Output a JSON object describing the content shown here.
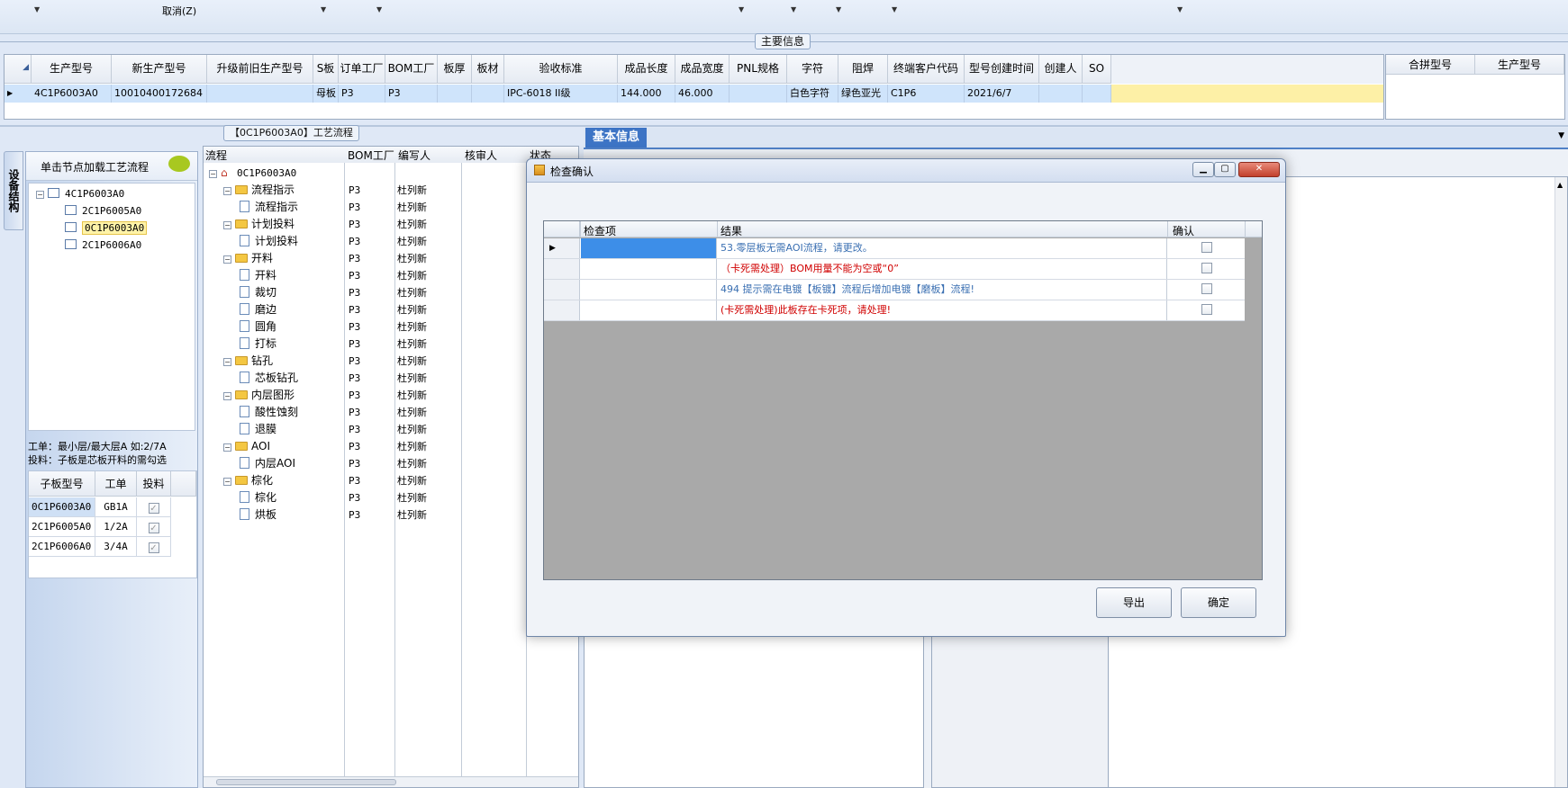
{
  "topbar": {
    "cancel_label": "取消(Z)"
  },
  "main_info": {
    "title": "主要信息",
    "columns": [
      "生产型号",
      "新生产型号",
      "升级前旧生产型号",
      "S板",
      "订单工厂",
      "BOM工厂",
      "板厚",
      "板材",
      "验收标准",
      "成品长度",
      "成品宽度",
      "PNL规格",
      "字符",
      "阻焊",
      "终端客户代码",
      "型号创建时间",
      "创建人",
      "SO"
    ],
    "row": [
      "4C1P6003A0",
      "10010400172684",
      "",
      "母板",
      "P3",
      "P3",
      "",
      "",
      "IPC-6018 II级",
      "144.000",
      "46.000",
      "",
      "白色字符",
      "绿色亚光",
      "C1P6",
      "2021/6/7",
      "",
      ""
    ],
    "side_columns": [
      "合拼型号",
      "生产型号"
    ]
  },
  "left_panel": {
    "vertical_tab": "设备结构",
    "hint": "单击节点加载工艺流程",
    "tree": [
      {
        "label": "4C1P6003A0",
        "level": 0
      },
      {
        "label": "2C1P6005A0",
        "level": 1
      },
      {
        "label": "0C1P6003A0",
        "level": 1,
        "selected": true
      },
      {
        "label": "2C1P6006A0",
        "level": 1
      }
    ],
    "note_line1": "工单：最小层/最大层A 如:2/7A",
    "note_line2": "投料：子板是芯板开料的需勾选",
    "sub_columns": [
      "子板型号",
      "工单",
      "投料"
    ],
    "sub_rows": [
      {
        "model": "0C1P6003A0",
        "order": "GB1A",
        "feed": true
      },
      {
        "model": "2C1P6005A0",
        "order": "1/2A",
        "feed": true
      },
      {
        "model": "2C1P6006A0",
        "order": "3/4A",
        "feed": true
      }
    ]
  },
  "process": {
    "title": "【0C1P6003A0】工艺流程",
    "columns": [
      "流程",
      "BOM工厂",
      "编写人",
      "核审人",
      "状态"
    ],
    "root": "0C1P6003A0",
    "rows": [
      {
        "label": "流程指示",
        "type": "folder",
        "bom": "P3",
        "who": "杜列新"
      },
      {
        "label": "流程指示",
        "type": "doc",
        "bom": "P3",
        "who": "杜列新"
      },
      {
        "label": "计划投料",
        "type": "folder",
        "bom": "P3",
        "who": "杜列新"
      },
      {
        "label": "计划投料",
        "type": "doc",
        "bom": "P3",
        "who": "杜列新"
      },
      {
        "label": "开料",
        "type": "folder",
        "bom": "P3",
        "who": "杜列新"
      },
      {
        "label": "开料",
        "type": "doc",
        "bom": "P3",
        "who": "杜列新"
      },
      {
        "label": "裁切",
        "type": "doc",
        "bom": "P3",
        "who": "杜列新"
      },
      {
        "label": "磨边",
        "type": "doc",
        "bom": "P3",
        "who": "杜列新"
      },
      {
        "label": "圆角",
        "type": "doc",
        "bom": "P3",
        "who": "杜列新"
      },
      {
        "label": "打标",
        "type": "doc",
        "bom": "P3",
        "who": "杜列新"
      },
      {
        "label": "钻孔",
        "type": "folder",
        "bom": "P3",
        "who": "杜列新"
      },
      {
        "label": "芯板钻孔",
        "type": "doc",
        "bom": "P3",
        "who": "杜列新"
      },
      {
        "label": "内层图形",
        "type": "folder",
        "bom": "P3",
        "who": "杜列新"
      },
      {
        "label": "酸性蚀刻",
        "type": "doc",
        "bom": "P3",
        "who": "杜列新"
      },
      {
        "label": "退膜",
        "type": "doc",
        "bom": "P3",
        "who": "杜列新"
      },
      {
        "label": "AOI",
        "type": "folder",
        "bom": "P3",
        "who": "杜列新"
      },
      {
        "label": "内层AOI",
        "type": "doc",
        "bom": "P3",
        "who": "杜列新"
      },
      {
        "label": "棕化",
        "type": "folder",
        "bom": "P3",
        "who": "杜列新"
      },
      {
        "label": "棕化",
        "type": "doc",
        "bom": "P3",
        "who": "杜列新"
      },
      {
        "label": "烘板",
        "type": "doc",
        "bom": "P3",
        "who": "杜列新"
      }
    ]
  },
  "right_tabs": {
    "basic_info": "基本信息"
  },
  "dialog": {
    "title": "检查确认",
    "columns": [
      "检查项",
      "结果",
      "确认"
    ],
    "rows": [
      {
        "item": "",
        "result": "53.零层板无需AOI流程，请更改。",
        "color": "#3a6fb2",
        "checked": false
      },
      {
        "item": "",
        "result": "（卡死需处理）BOM用量不能为空或“0”",
        "color": "#d00000",
        "checked": false
      },
      {
        "item": "",
        "result": "494 提示需在电镀【板镀】流程后增加电镀【磨板】流程!",
        "color": "#3a6fb2",
        "checked": false
      },
      {
        "item": "",
        "result": "(卡死需处理)此板存在卡死项，请处理!",
        "color": "#d00000",
        "checked": false
      }
    ],
    "export_label": "导出",
    "ok_label": "确定"
  }
}
